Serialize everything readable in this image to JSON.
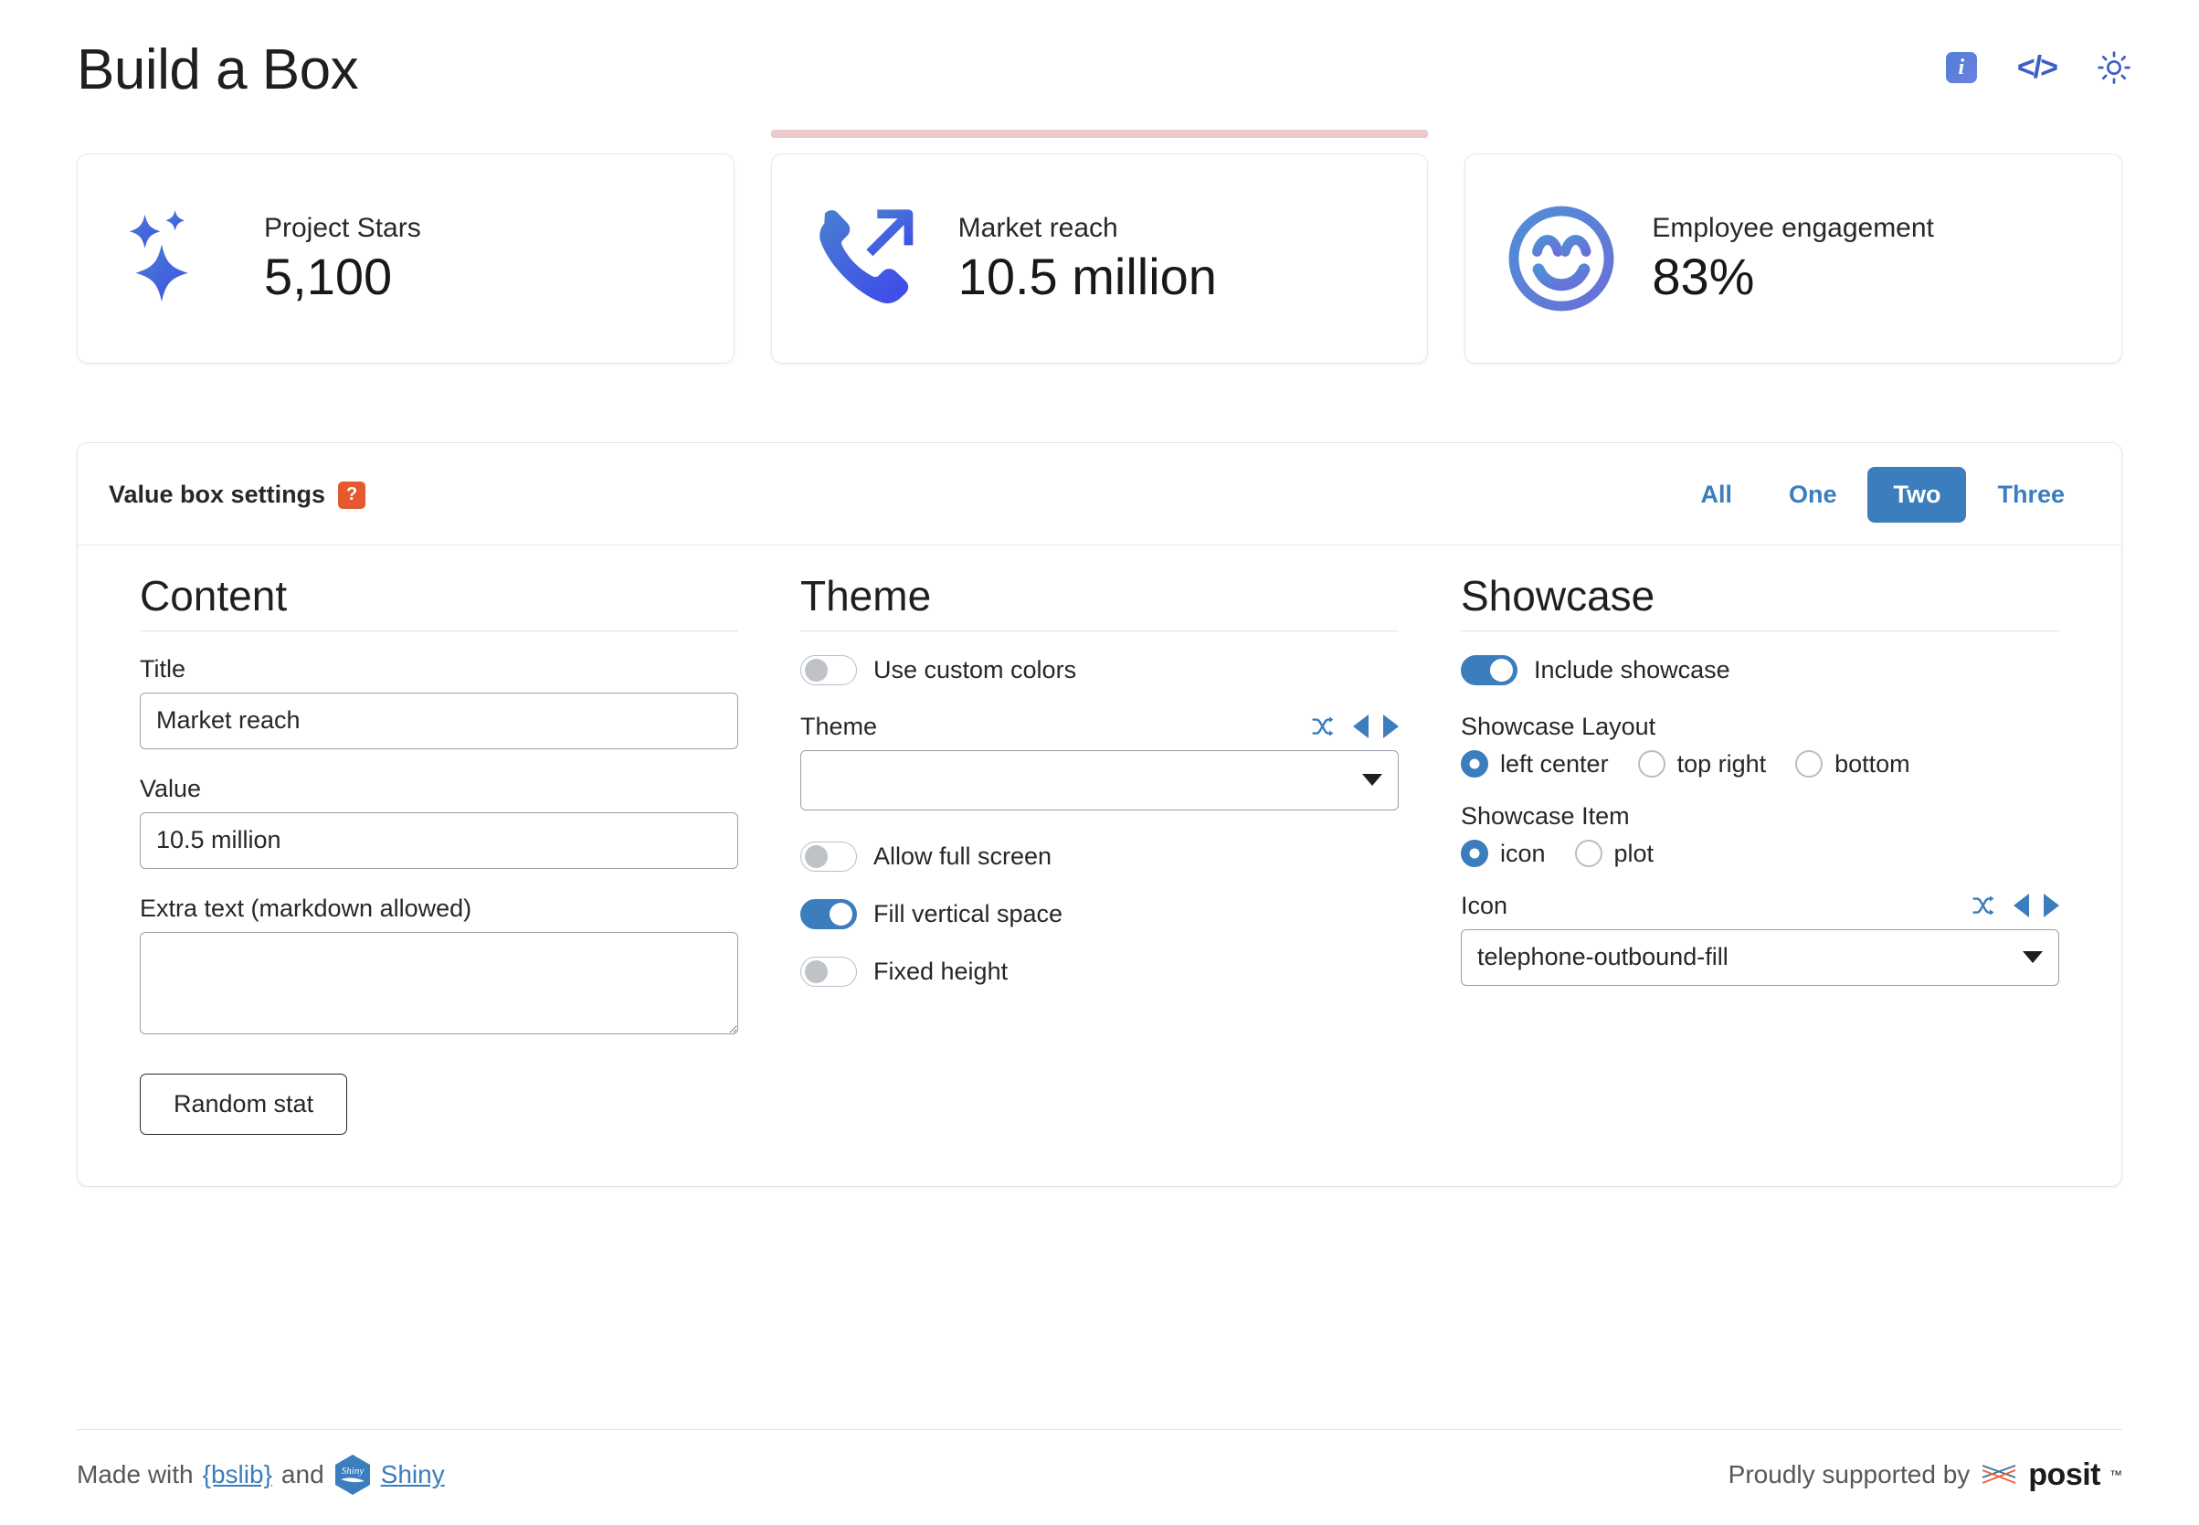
{
  "header": {
    "title": "Build a Box",
    "icons": [
      {
        "name": "info-icon",
        "glyph": "i"
      },
      {
        "name": "code-icon",
        "glyph": "</>"
      },
      {
        "name": "sun-icon",
        "glyph": "sun"
      }
    ]
  },
  "value_boxes": [
    {
      "title": "Project Stars",
      "value": "5,100",
      "icon": "stars-fill",
      "selected": false
    },
    {
      "title": "Market reach",
      "value": "10.5 million",
      "icon": "telephone-outbound-fill",
      "selected": true,
      "marker_color": "#edc9c9"
    },
    {
      "title": "Employee engagement",
      "value": "83%",
      "icon": "emoji-smile",
      "selected": false
    }
  ],
  "settings": {
    "title": "Value box settings",
    "help_badge": "?",
    "tabs": [
      {
        "label": "All",
        "active": false
      },
      {
        "label": "One",
        "active": false
      },
      {
        "label": "Two",
        "active": true
      },
      {
        "label": "Three",
        "active": false
      }
    ],
    "content": {
      "heading": "Content",
      "title_label": "Title",
      "title_value": "Market reach",
      "value_label": "Value",
      "value_value": "10.5 million",
      "extra_label": "Extra text (markdown allowed)",
      "extra_value": "",
      "extra_placeholder": "",
      "random_button": "Random stat"
    },
    "theme": {
      "heading": "Theme",
      "custom_colors_label": "Use custom colors",
      "custom_colors_on": false,
      "theme_label": "Theme",
      "theme_value": "",
      "full_screen_label": "Allow full screen",
      "full_screen_on": false,
      "fill_label": "Fill vertical space",
      "fill_on": true,
      "fixed_height_label": "Fixed height",
      "fixed_height_on": false,
      "nav_icons": [
        "shuffle-icon",
        "previous-icon",
        "next-icon"
      ]
    },
    "showcase": {
      "heading": "Showcase",
      "include_label": "Include showcase",
      "include_on": true,
      "layout_label": "Showcase Layout",
      "layout_options": [
        {
          "label": "left center",
          "checked": true
        },
        {
          "label": "top right",
          "checked": false
        },
        {
          "label": "bottom",
          "checked": false
        }
      ],
      "item_label": "Showcase Item",
      "item_options": [
        {
          "label": "icon",
          "checked": true
        },
        {
          "label": "plot",
          "checked": false
        }
      ],
      "icon_label": "Icon",
      "icon_value": "telephone-outbound-fill",
      "nav_icons": [
        "shuffle-icon",
        "previous-icon",
        "next-icon"
      ]
    }
  },
  "footer": {
    "made_with": "Made with",
    "bslib": "{bslib}",
    "and": "and",
    "shiny": "Shiny",
    "supported_by": "Proudly supported by",
    "posit": "posit",
    "tm": "™"
  },
  "colors": {
    "accent_blue": "#3b7dbd",
    "help_orange": "#e4592e",
    "marker_pink": "#edc9c9",
    "icon_gradient_start": "#4a7fd0",
    "icon_gradient_end": "#3f4fe8"
  }
}
